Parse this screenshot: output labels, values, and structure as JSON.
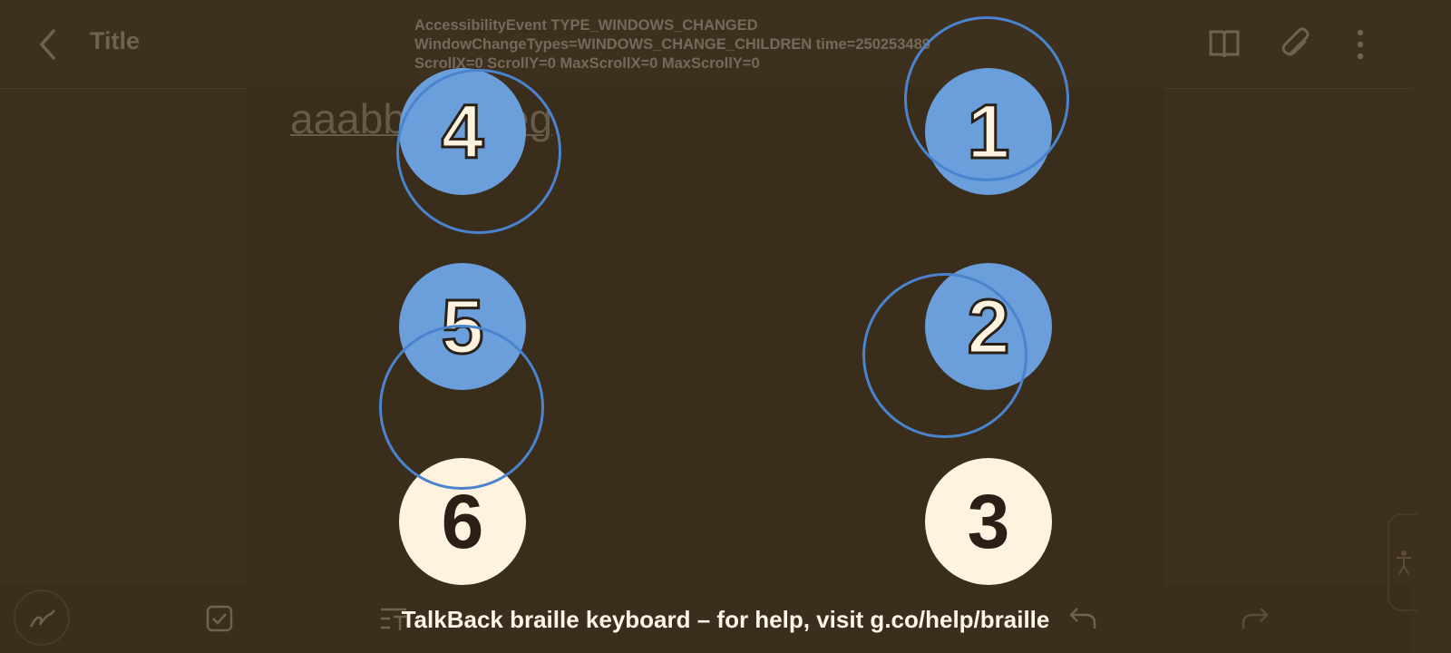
{
  "app": {
    "title": "Title",
    "note_text": "aaabbbcghieg"
  },
  "debug": {
    "event_text": "AccessibilityEvent  TYPE_WINDOWS_CHANGED\nWindowChangeTypes=WINDOWS_CHANGE_CHILDREN  time=250253489\nScrollX=0  ScrollY=0  MaxScrollX=0  MaxScrollY=0"
  },
  "braille_dots": [
    {
      "label": "1",
      "state": "active"
    },
    {
      "label": "2",
      "state": "active"
    },
    {
      "label": "3",
      "state": "inactive"
    },
    {
      "label": "4",
      "state": "active"
    },
    {
      "label": "5",
      "state": "active"
    },
    {
      "label": "6",
      "state": "inactive"
    }
  ],
  "banner": "TalkBack braille keyboard – for help, visit g.co/help/braille",
  "icons": {
    "back": "back-arrow-icon",
    "reader": "book-icon",
    "attach": "paperclip-icon",
    "more": "more-vert-icon",
    "pen": "pen-icon",
    "checkbox": "checkbox-icon",
    "text_format": "text-format-icon",
    "undo": "undo-icon",
    "redo": "redo-icon",
    "accessibility": "accessibility-icon"
  },
  "colors": {
    "background": "#3d301e",
    "dot_active": "#6a9fdb",
    "dot_inactive": "#fff3e0",
    "touch_ring": "#4a84cf"
  }
}
